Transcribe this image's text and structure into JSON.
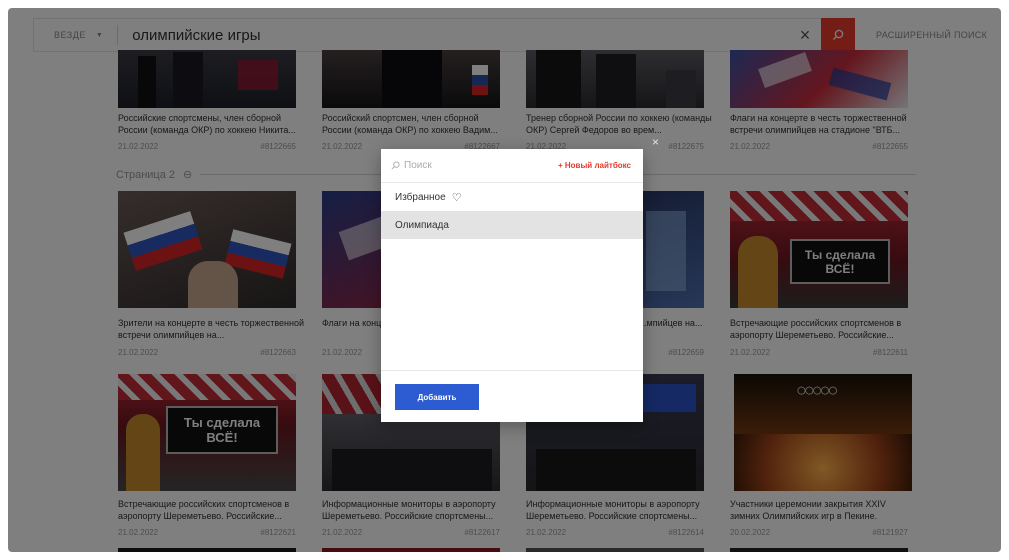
{
  "search": {
    "scope_label": "ВЕЗДЕ",
    "query": "олимпийские игры",
    "advanced_label": "РАСШИРЕННЫЙ ПОИСК"
  },
  "page_separator": "Страница 2",
  "rows": [
    [
      {
        "caption": "Российские спортсмены, член сборной России (команда ОКР) по хоккею Никита...",
        "date": "21.02.2022",
        "id": "#8122665"
      },
      {
        "caption": "Российский спортсмен, член сборной России (команда ОКР) по хоккею Вадим...",
        "date": "21.02.2022",
        "id": "#8122667"
      },
      {
        "caption": "Тренер сборной России по хоккею (команды ОКР) Сергей Федоров во врем...",
        "date": "21.02.2022",
        "id": "#8122675"
      },
      {
        "caption": "Флаги на концерте в честь торжественной встречи олимпийцев на стадионе \"ВТБ...",
        "date": "21.02.2022",
        "id": "#8122655"
      }
    ],
    [
      {
        "caption": "Зрители на концерте в честь торжественной встречи олимпийцев на...",
        "date": "21.02.2022",
        "id": "#8122663"
      },
      {
        "caption": "Флаги на конц... встречи олимп...",
        "date": "21.02.2022",
        "id": ""
      },
      {
        "caption": "...честь ...мпийцев на...",
        "date": "",
        "id": "#8122659"
      },
      {
        "caption": "Встречающие российских спортсменов в аэропорту Шереметьево. Российские...",
        "date": "21.02.2022",
        "id": "#8122611"
      }
    ],
    [
      {
        "caption": "Встречающие российских спортсменов в аэропорту Шереметьево. Российские...",
        "date": "21.02.2022",
        "id": "#8122621"
      },
      {
        "caption": "Информационные мониторы в аэропорту Шереметьево. Российские спортсмены...",
        "date": "21.02.2022",
        "id": "#8122617"
      },
      {
        "caption": "Информационные мониторы в аэропорту Шереметьево. Российские спортсмены...",
        "date": "21.02.2022",
        "id": "#8122614"
      },
      {
        "caption": "Участники церемонии закрытия XXIV зимних Олимпийских игр в Пекине.",
        "date": "20.02.2022",
        "id": "#8121927"
      }
    ]
  ],
  "banners": {
    "you_did_it": "Ты сделала ВСЁ!"
  },
  "modal": {
    "search_placeholder": "Поиск",
    "new_lightbox": "+ Новый лайтбокс",
    "items": [
      {
        "label": "Избранное",
        "favorite": true
      },
      {
        "label": "Олимпиада",
        "favorite": false
      }
    ],
    "add_button": "Добавить"
  },
  "colors": {
    "accent_red": "#e8382c",
    "button_blue": "#2d5bd1"
  }
}
